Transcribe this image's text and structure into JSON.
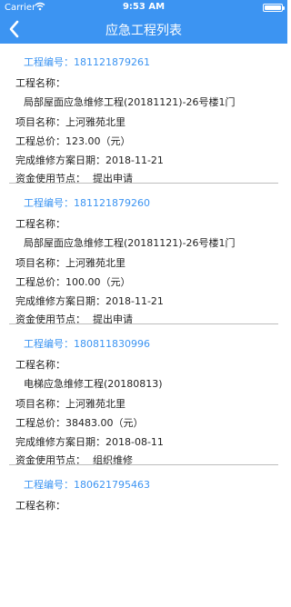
{
  "status_bar": {
    "carrier": "Carrier",
    "time": "9:53 AM"
  },
  "nav": {
    "title": "应急工程列表",
    "back_icon": "chevron-left-icon"
  },
  "records": [
    {
      "code_label": "工程编号：",
      "code": "181121879261",
      "name_label": "工程名称：",
      "name": "局部屋面应急维修工程(20181121)-26号楼1门",
      "project_label": "项目名称：",
      "project": "上河雅苑北里",
      "total_label": "工程总价：",
      "total": "123.00（元）",
      "date_label": "完成维修方案日期：",
      "date": "2018-11-21",
      "node_label": "资金使用节点：",
      "node": "提出申请"
    },
    {
      "code_label": "工程编号：",
      "code": "181121879260",
      "name_label": "工程名称：",
      "name": "局部屋面应急维修工程(20181121)-26号楼1门",
      "project_label": "项目名称：",
      "project": "上河雅苑北里",
      "total_label": "工程总价：",
      "total": "100.00（元）",
      "date_label": "完成维修方案日期：",
      "date": "2018-11-21",
      "node_label": "资金使用节点：",
      "node": "提出申请"
    },
    {
      "code_label": "工程编号：",
      "code": "180811830996",
      "name_label": "工程名称：",
      "name": "电梯应急维修工程(20180813)",
      "project_label": "项目名称：",
      "project": "上河雅苑北里",
      "total_label": "工程总价：",
      "total": "38483.00（元）",
      "date_label": "完成维修方案日期：",
      "date": "2018-08-11",
      "node_label": "资金使用节点：",
      "node": "组织维修"
    },
    {
      "code_label": "工程编号：",
      "code": "180621795463",
      "name_label": "工程名称："
    }
  ]
}
